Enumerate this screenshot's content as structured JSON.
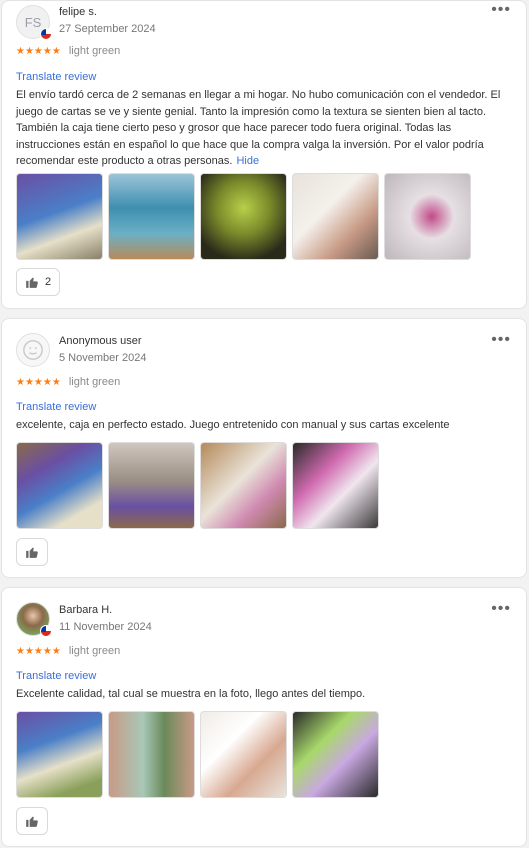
{
  "reviews": [
    {
      "initials": "FS",
      "name": "felipe s.",
      "date": "27 September 2024",
      "stars": "★★★★★",
      "variant": "light green",
      "translate_label": "Translate review",
      "text": "El envío tardó cerca de 2 semanas en llegar a mi hogar. No hubo comunicación con el vendedor. El juego de cartas se ve y siente genial. Tanto la impresión como la textura se sienten bien al tacto. También la caja tiene cierto peso y grosor que hace parecer todo fuera original. Todas las instrucciones están en español lo que hace que la compra valga la inversión. Por el valor podría recomendar este producto a otras personas.",
      "hide_label": "Hide",
      "like_count": "2",
      "photo_count": 5
    },
    {
      "name": "Anonymous user",
      "date": "5 November 2024",
      "stars": "★★★★★",
      "variant": "light green",
      "translate_label": "Translate review",
      "text": "excelente, caja en perfecto estado. Juego entretenido con manual y sus cartas excelente",
      "photo_count": 4
    },
    {
      "name": "Barbara H.",
      "date": "11 November 2024",
      "stars": "★★★★★",
      "variant": "light green",
      "translate_label": "Translate review",
      "text": "Excelente calidad, tal cual se muestra en la foto, llego antes del tiempo.",
      "photo_count": 4
    }
  ],
  "colors": {
    "accent_link": "#3a6fd8",
    "star": "#fd7e14",
    "card_border": "#e3e3e3"
  },
  "icons": [
    "more-options-icon",
    "thumbs-up-icon",
    "chile-flag-icon",
    "anonymous-avatar-icon"
  ]
}
